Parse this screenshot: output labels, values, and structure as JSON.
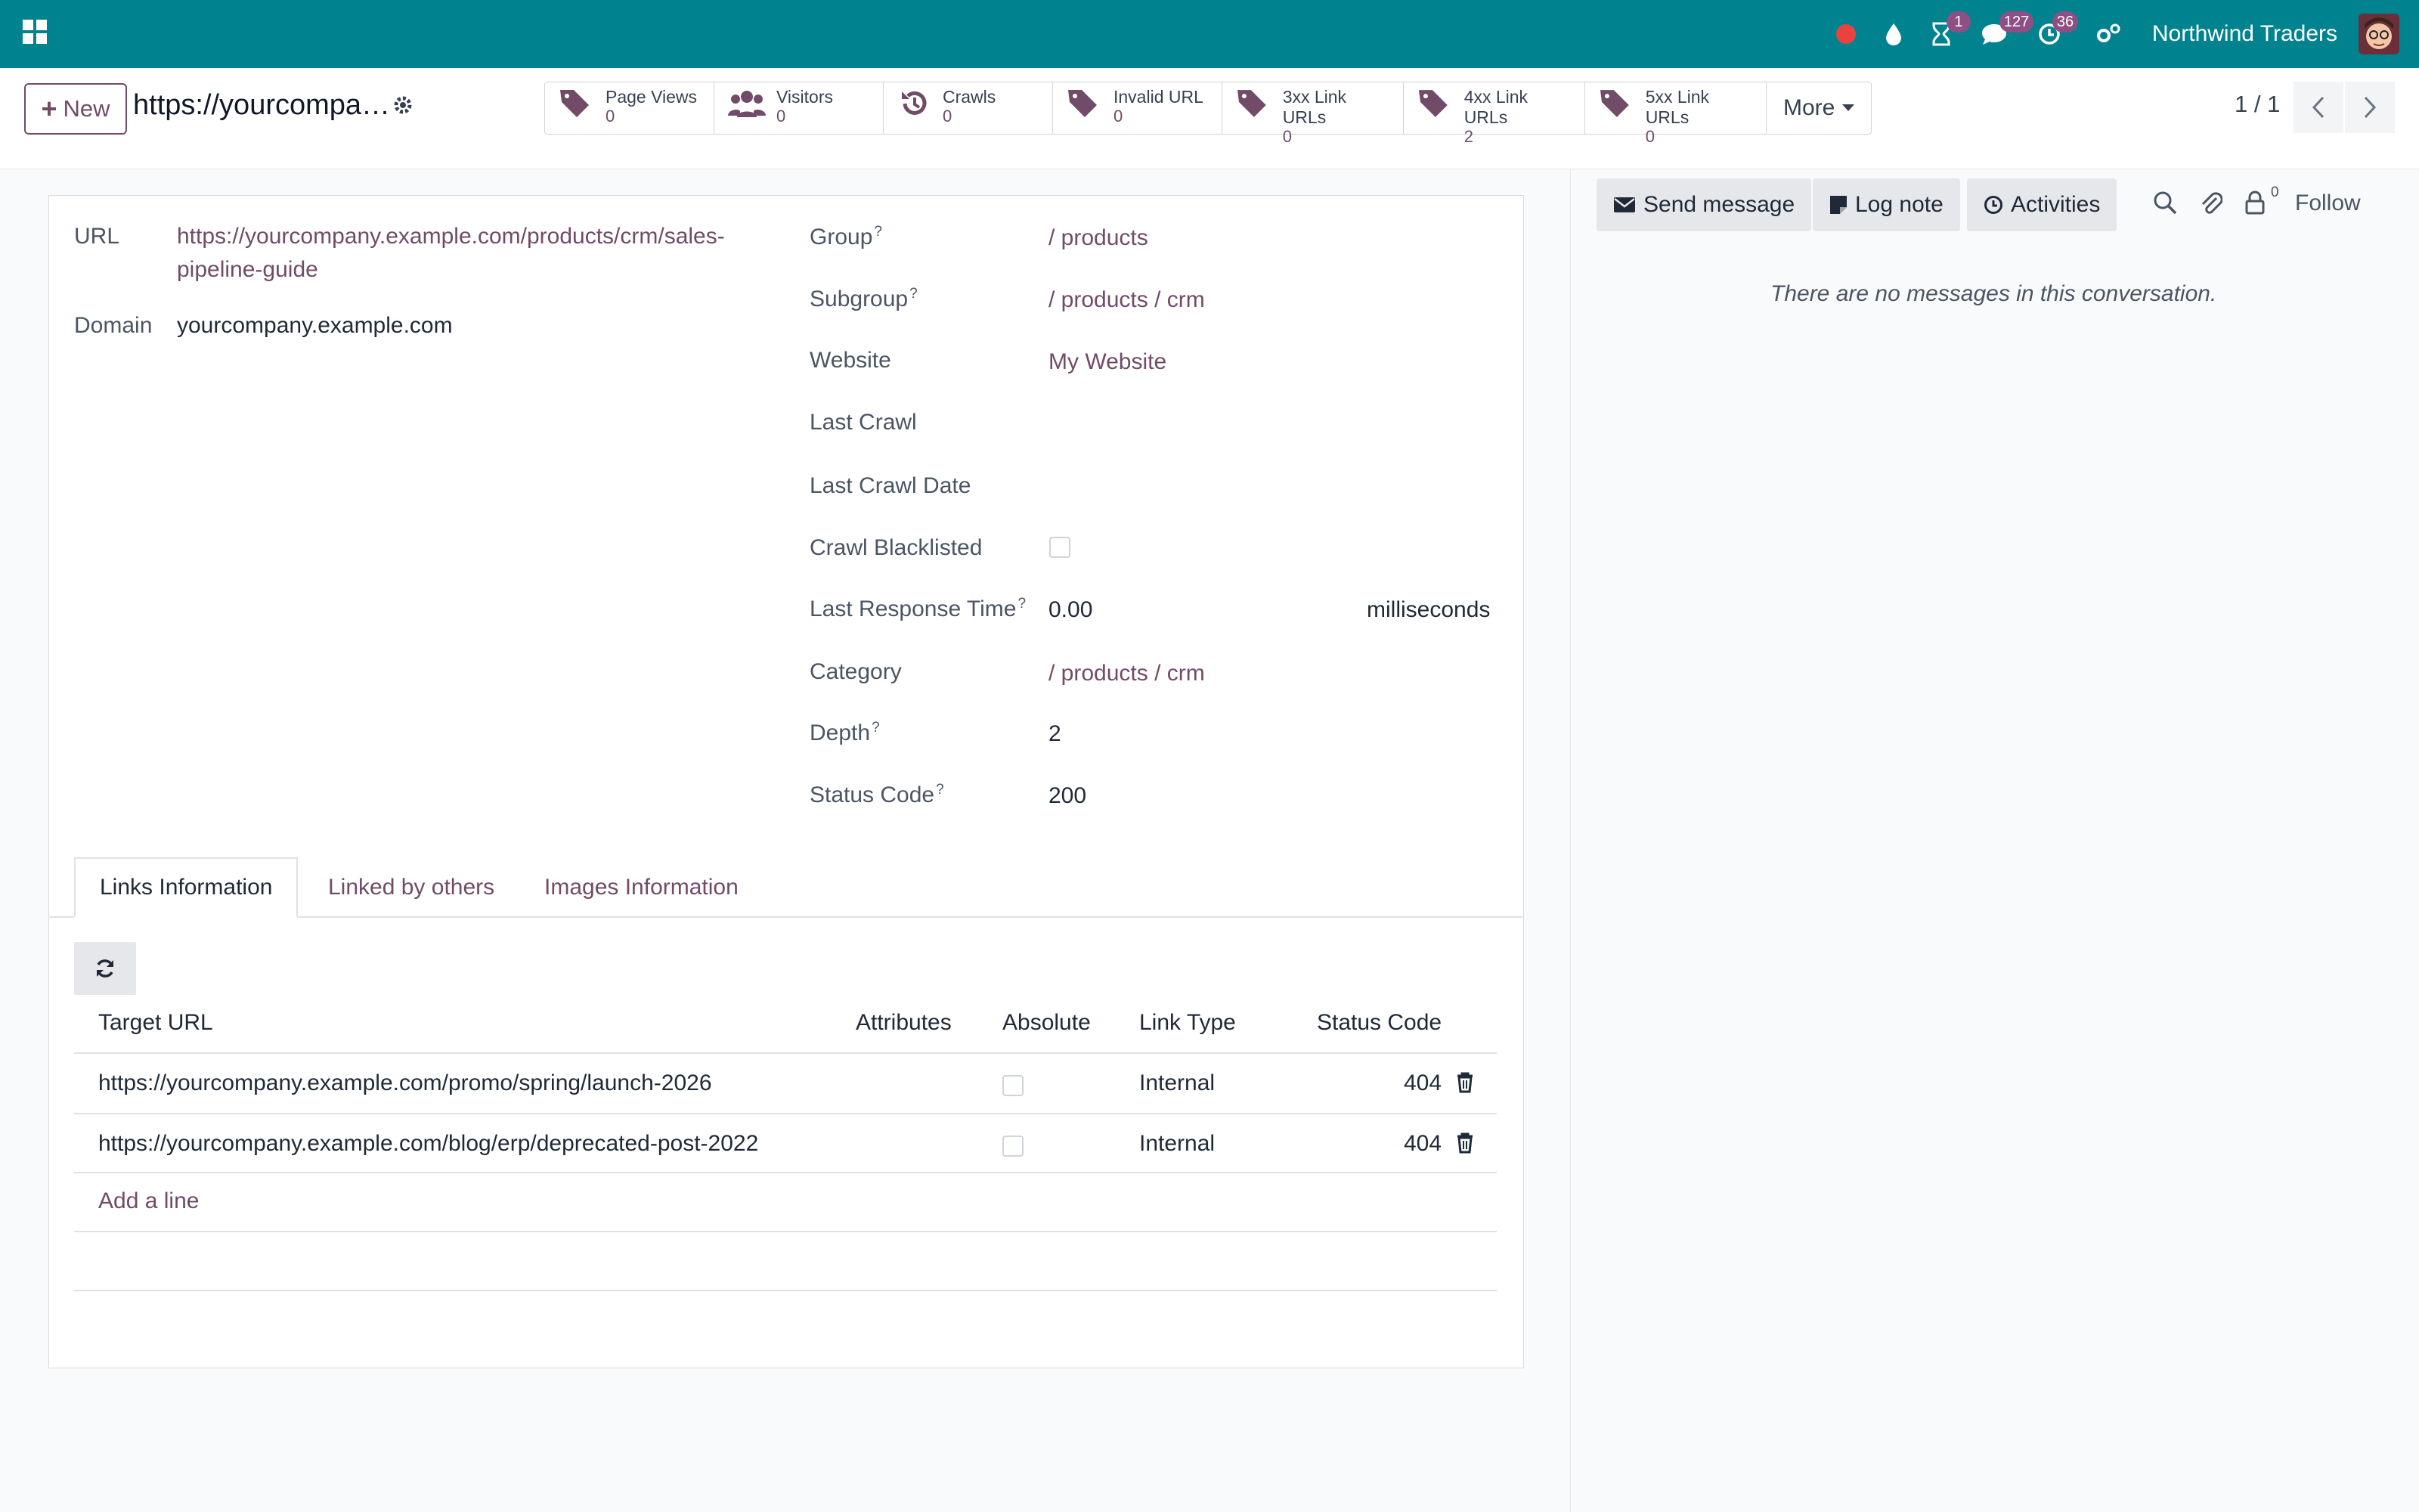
{
  "navbar": {
    "company": "Northwind Traders",
    "badges": {
      "activity": "1",
      "messages": "127",
      "clock": "36"
    }
  },
  "control_panel": {
    "new_label": "New",
    "record_title": "https://yourcompa…",
    "stats": [
      {
        "label": "Page Views",
        "value": "0",
        "icon": "tags-icon"
      },
      {
        "label": "Visitors",
        "value": "0",
        "icon": "users-icon"
      },
      {
        "label": "Crawls",
        "value": "0",
        "icon": "history-icon"
      },
      {
        "label": "Invalid URL",
        "value": "0",
        "icon": "tags-icon"
      },
      {
        "label": "3xx Link URLs",
        "value": "0",
        "icon": "tags-icon"
      },
      {
        "label": "4xx Link URLs",
        "value": "2",
        "icon": "tags-icon"
      },
      {
        "label": "5xx Link URLs",
        "value": "0",
        "icon": "tags-icon"
      }
    ],
    "more_label": "More",
    "pager": "1 / 1"
  },
  "form": {
    "url_label": "URL",
    "url_line1": "https://yourcompany.example.com/products/crm/sales-",
    "url_line2": "pipeline-guide",
    "domain_label": "Domain",
    "domain_value": "yourcompany.example.com",
    "fields": {
      "group_label": "Group",
      "group_value": "/ products",
      "subgroup_label": "Subgroup",
      "subgroup_value": "/ products / crm",
      "website_label": "Website",
      "website_value": "My Website",
      "last_crawl_label": "Last Crawl",
      "last_crawl_date_label": "Last Crawl Date",
      "crawl_blacklisted_label": "Crawl Blacklisted",
      "last_response_label": "Last Response Time",
      "last_response_value": "0.00",
      "last_response_unit": "milliseconds",
      "category_label": "Category",
      "category_value": "/ products / crm",
      "depth_label": "Depth",
      "depth_value": "2",
      "status_code_label": "Status Code",
      "status_code_value": "200",
      "help_mark": "?"
    },
    "tabs": [
      "Links Information",
      "Linked by others",
      "Images Information"
    ],
    "table": {
      "headers": [
        "Target URL",
        "Attributes",
        "Absolute",
        "Link Type",
        "Status Code"
      ],
      "rows": [
        {
          "target": "https://yourcompany.example.com/promo/spring/launch-2026",
          "link_type": "Internal",
          "status": "404"
        },
        {
          "target": "https://yourcompany.example.com/blog/erp/deprecated-post-2022",
          "link_type": "Internal",
          "status": "404"
        }
      ],
      "add_line": "Add a line"
    }
  },
  "chatter": {
    "send_message": "Send message",
    "log_note": "Log note",
    "activities": "Activities",
    "attachments_count": "0",
    "follow": "Follow",
    "empty": "There are no messages in this conversation."
  },
  "colors": {
    "navbar": "#01838f",
    "accent": "#714b67",
    "badge": "#8e4f85"
  }
}
